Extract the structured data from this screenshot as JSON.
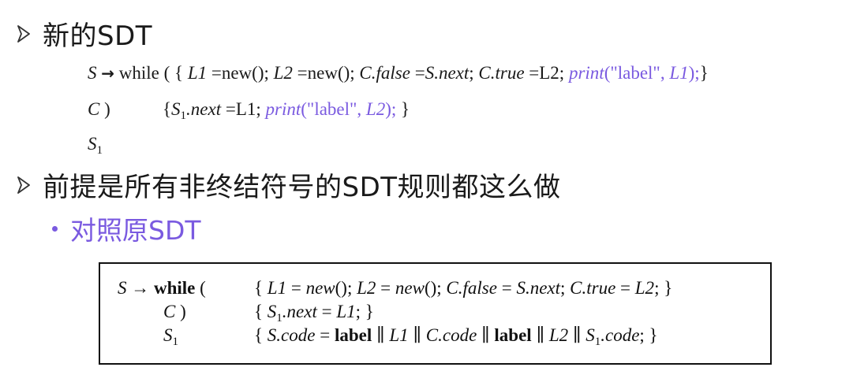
{
  "heading1": "新的SDT",
  "sdt_new": {
    "row1": {
      "S": "S",
      "arrow": "→",
      "while_kw": " while ( ",
      "brace_open": "{",
      "L1": " L1",
      "assign1": " =new(); ",
      "L2": "L2",
      "assign2": " =new(); ",
      "Cfalse": "C.false",
      "eq1": " =",
      "Snext": "S.next",
      "semi1": "; ",
      "Ctrue": "C.true",
      "eq2": " =L2; ",
      "print_fn": "print",
      "print_args_open": "(\"label\", ",
      "print_var": "L1",
      "print_close": ");",
      "brace_close": "}"
    },
    "row2": {
      "C": "C",
      "paren": " )",
      "brace_open": "{",
      "S": "S",
      "sub": "1",
      "next": ".next",
      "assign": " =L1; ",
      "print_fn": "print",
      "print_args_open": "(\"label\", ",
      "print_var": "L2",
      "print_close": "); ",
      "brace_close": "}"
    },
    "row3": {
      "S": "S",
      "sub": "1"
    }
  },
  "heading2": "前提是所有非终结符号的SDT规则都这么做",
  "subbullet": "对照原SDT",
  "original_sdt": {
    "row1": {
      "S": "S",
      "arrow": " → ",
      "while_kw": "while",
      "paren": " (",
      "brace_open": "{ ",
      "L1": "L1",
      "eq1": " = ",
      "new1": "new",
      "paren1": "(); ",
      "L2": "L2",
      "eq2": " = ",
      "new2": "new",
      "paren2": "(); ",
      "Cfalse": "C.false",
      "eq3": " = ",
      "Snext": "S.next",
      "semi": "; ",
      "Ctrue": "C.true",
      "eq4": " = ",
      "L2b": "L2",
      "end": "; }"
    },
    "row2": {
      "C": "C",
      "paren": " )",
      "brace_open": "{ ",
      "S": "S",
      "sub": "1",
      "next": ".next",
      "eq": " = ",
      "L1": "L1",
      "end": "; }"
    },
    "row3": {
      "S": "S",
      "sub": "1",
      "brace_open": "{ ",
      "S_code": "S.code",
      "eq": " = ",
      "label1": "label",
      "or1": " ∥ ",
      "L1": "L1",
      "or2": " ∥ ",
      "C_code": "C.code",
      "or3": " ∥ ",
      "label2": "label",
      "or4": " ∥ ",
      "L2": "L2",
      "or5": " ∥ ",
      "S2": "S",
      "sub2": "1",
      "code": ".code",
      "end": "; }"
    }
  },
  "colors": {
    "accent": "#7a5ae0",
    "text": "#1a1a1a",
    "bullet_arrow": "#333333"
  },
  "icons": {
    "bullet1": "arrow-bullet-icon",
    "bullet2": "arrow-bullet-icon",
    "sub_bullet": "dot-bullet-icon"
  }
}
